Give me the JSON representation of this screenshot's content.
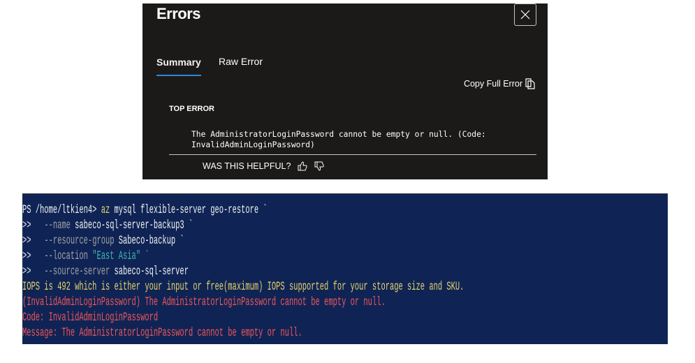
{
  "dialog": {
    "title": "Errors",
    "tabs": [
      {
        "label": "Summary",
        "active": true
      },
      {
        "label": "Raw Error",
        "active": false
      }
    ],
    "copy_label": "Copy Full Error",
    "top_error_label": "TOP ERROR",
    "error_message": "The AdministratorLoginPassword cannot be empty or null. (Code: InvalidAdminLoginPassword)",
    "helpful_label": "WAS THIS HELPFUL?"
  },
  "terminal": {
    "prompt": "PS /home/ltkien4> ",
    "cmd_az": "az",
    "cmd_rest": " mysql flexible-server geo-restore `",
    "cont": ">>",
    "lines": [
      {
        "flag": "--name",
        "value": " sabeco-sql-server-backup3 `"
      },
      {
        "flag": "--resource-group",
        "value": " Sabeco-backup `"
      },
      {
        "flag": "--location",
        "string": " \"East Asia\"",
        "value": " `"
      },
      {
        "flag": "--source-server",
        "value": " sabeco-sql-server"
      }
    ],
    "warning": "IOPS is 492 which is either your input or free(maximum) IOPS supported for your storage size and SKU.",
    "errors": [
      "(InvalidAdminLoginPassword) The AdministratorLoginPassword cannot be empty or null.",
      "Code: InvalidAdminLoginPassword",
      "Message: The AdministratorLoginPassword cannot be empty or null."
    ]
  },
  "colors": {
    "dialog_bg": "#1b1a19",
    "tab_accent": "#2b88d8",
    "terminal_bg": "#0f2455",
    "warning": "#e6d26a",
    "error": "#f0555a"
  }
}
